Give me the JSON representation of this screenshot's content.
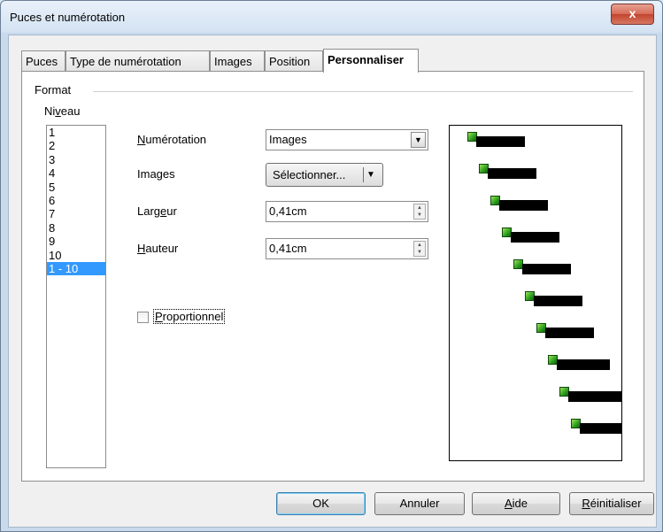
{
  "window": {
    "title": "Puces et numérotation",
    "close_label": "x"
  },
  "tabs": [
    {
      "label": "Puces"
    },
    {
      "label": "Type de numérotation"
    },
    {
      "label": "Images"
    },
    {
      "label": "Position"
    },
    {
      "label": "Personnaliser",
      "active": true
    }
  ],
  "format": {
    "group_label": "Format",
    "niveau_label": "Niveau",
    "levels": [
      "1",
      "2",
      "3",
      "4",
      "5",
      "6",
      "7",
      "8",
      "9",
      "10",
      "1 - 10"
    ],
    "selected_level": "1 - 10",
    "numerotation_label": "Numérotation",
    "numerotation_value": "Images",
    "images_label": "Images",
    "select_button_label": "Sélectionner...",
    "largeur_label": "Largeur",
    "largeur_value": "0,41cm",
    "hauteur_label": "Hauteur",
    "hauteur_value": "0,41cm",
    "proportionnel_label": "Proportionnel",
    "proportionnel_checked": false
  },
  "preview": {
    "bullet_icon": "green-square-image-bullet",
    "levels": 10
  },
  "buttons": {
    "ok": "OK",
    "cancel": "Annuler",
    "help": "Aide",
    "reset": "Réinitialiser"
  },
  "colors": {
    "selection": "#3399ff",
    "close_button": "#c9473a",
    "bullet_green": "#2a9c1c"
  }
}
